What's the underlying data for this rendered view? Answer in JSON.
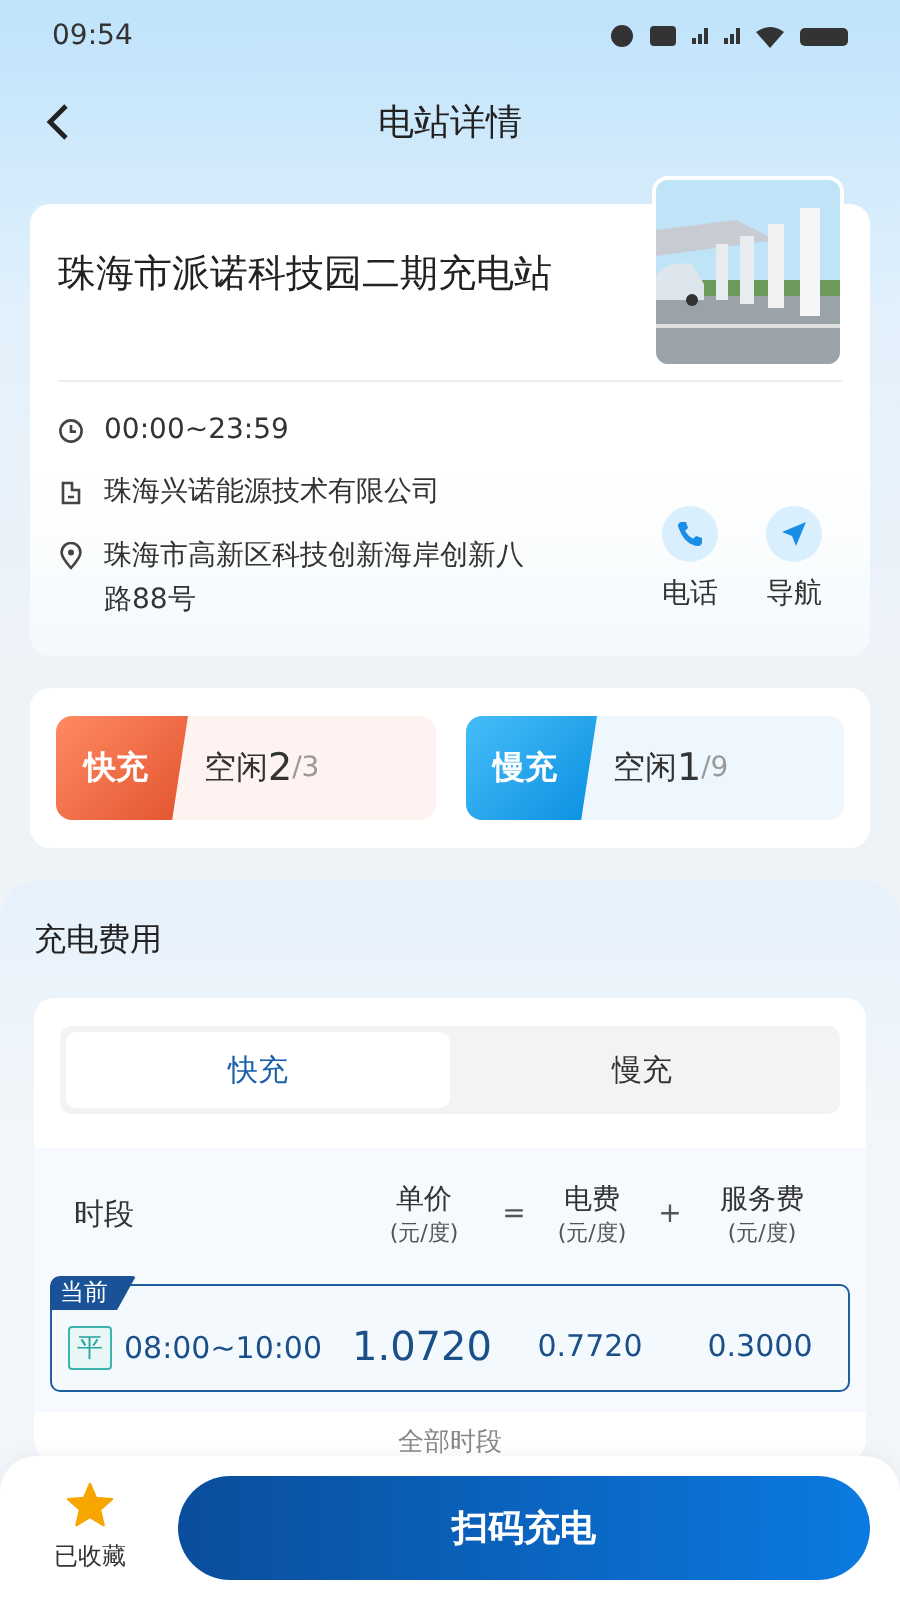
{
  "status_bar": {
    "time": "09:54"
  },
  "header": {
    "title": "电站详情"
  },
  "station": {
    "name": "珠海市派诺科技园二期充电站",
    "hours": "00:00~23:59",
    "company": "珠海兴诺能源技术有限公司",
    "address": "珠海市高新区科技创新海岸创新八路88号",
    "actions": [
      {
        "kind": "phone",
        "label": "电话"
      },
      {
        "kind": "navigate",
        "label": "导航"
      }
    ]
  },
  "availability": [
    {
      "kind": "fast",
      "type": "快充",
      "free_label": "空闲",
      "free": "2",
      "total": "/3"
    },
    {
      "kind": "slow",
      "type": "慢充",
      "free_label": "空闲",
      "free": "1",
      "total": "/9"
    }
  ],
  "fees": {
    "title": "充电费用",
    "tabs": [
      {
        "label": "快充",
        "selected": true
      },
      {
        "label": "慢充",
        "selected": false
      }
    ],
    "columns": {
      "period": "时段",
      "price": "单价",
      "price_unit": "(元/度)",
      "equals": "=",
      "electricity": "电费",
      "electricity_unit": "(元/度)",
      "plus": "+",
      "service": "服务费",
      "service_unit": "(元/度)"
    },
    "rows": [
      {
        "current": true,
        "badge": "当前",
        "tag": "平",
        "period": "08:00~10:00",
        "price": "1.0720",
        "electricity": "0.7720",
        "service": "0.3000"
      }
    ],
    "more": "全部时段"
  },
  "bottom_bar": {
    "favorite": {
      "label": "已收藏",
      "on": true
    },
    "primary_button": "扫码充电"
  }
}
